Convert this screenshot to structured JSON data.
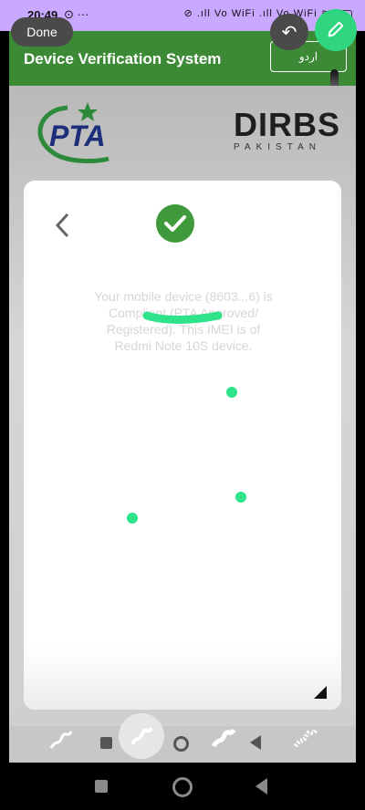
{
  "status": {
    "time": "20:49",
    "left_icons": "⊙ ···",
    "right_icons": "⊘ .ıll Vo WiFi .ıll Vo WiFi ≋"
  },
  "header": {
    "title": "Device Verification System",
    "lang_button": "اردو"
  },
  "annotation": {
    "done_label": "Done",
    "undo_icon": "↶",
    "pen_icon": "pencil-icon"
  },
  "logos": {
    "pta": "PTA",
    "dirbs": "DIRBS",
    "dirbs_sub": "PAKISTAN"
  },
  "message": {
    "text": "Your mobile device (8603...6) is Compliant (PTA Approved/ Registered). This IMEI is of Redmi Note 10S device."
  },
  "colors": {
    "header": "#3c8a35",
    "status_bar": "#c9a8ff",
    "accent": "#2fe38a",
    "check": "#3e9a3b"
  }
}
